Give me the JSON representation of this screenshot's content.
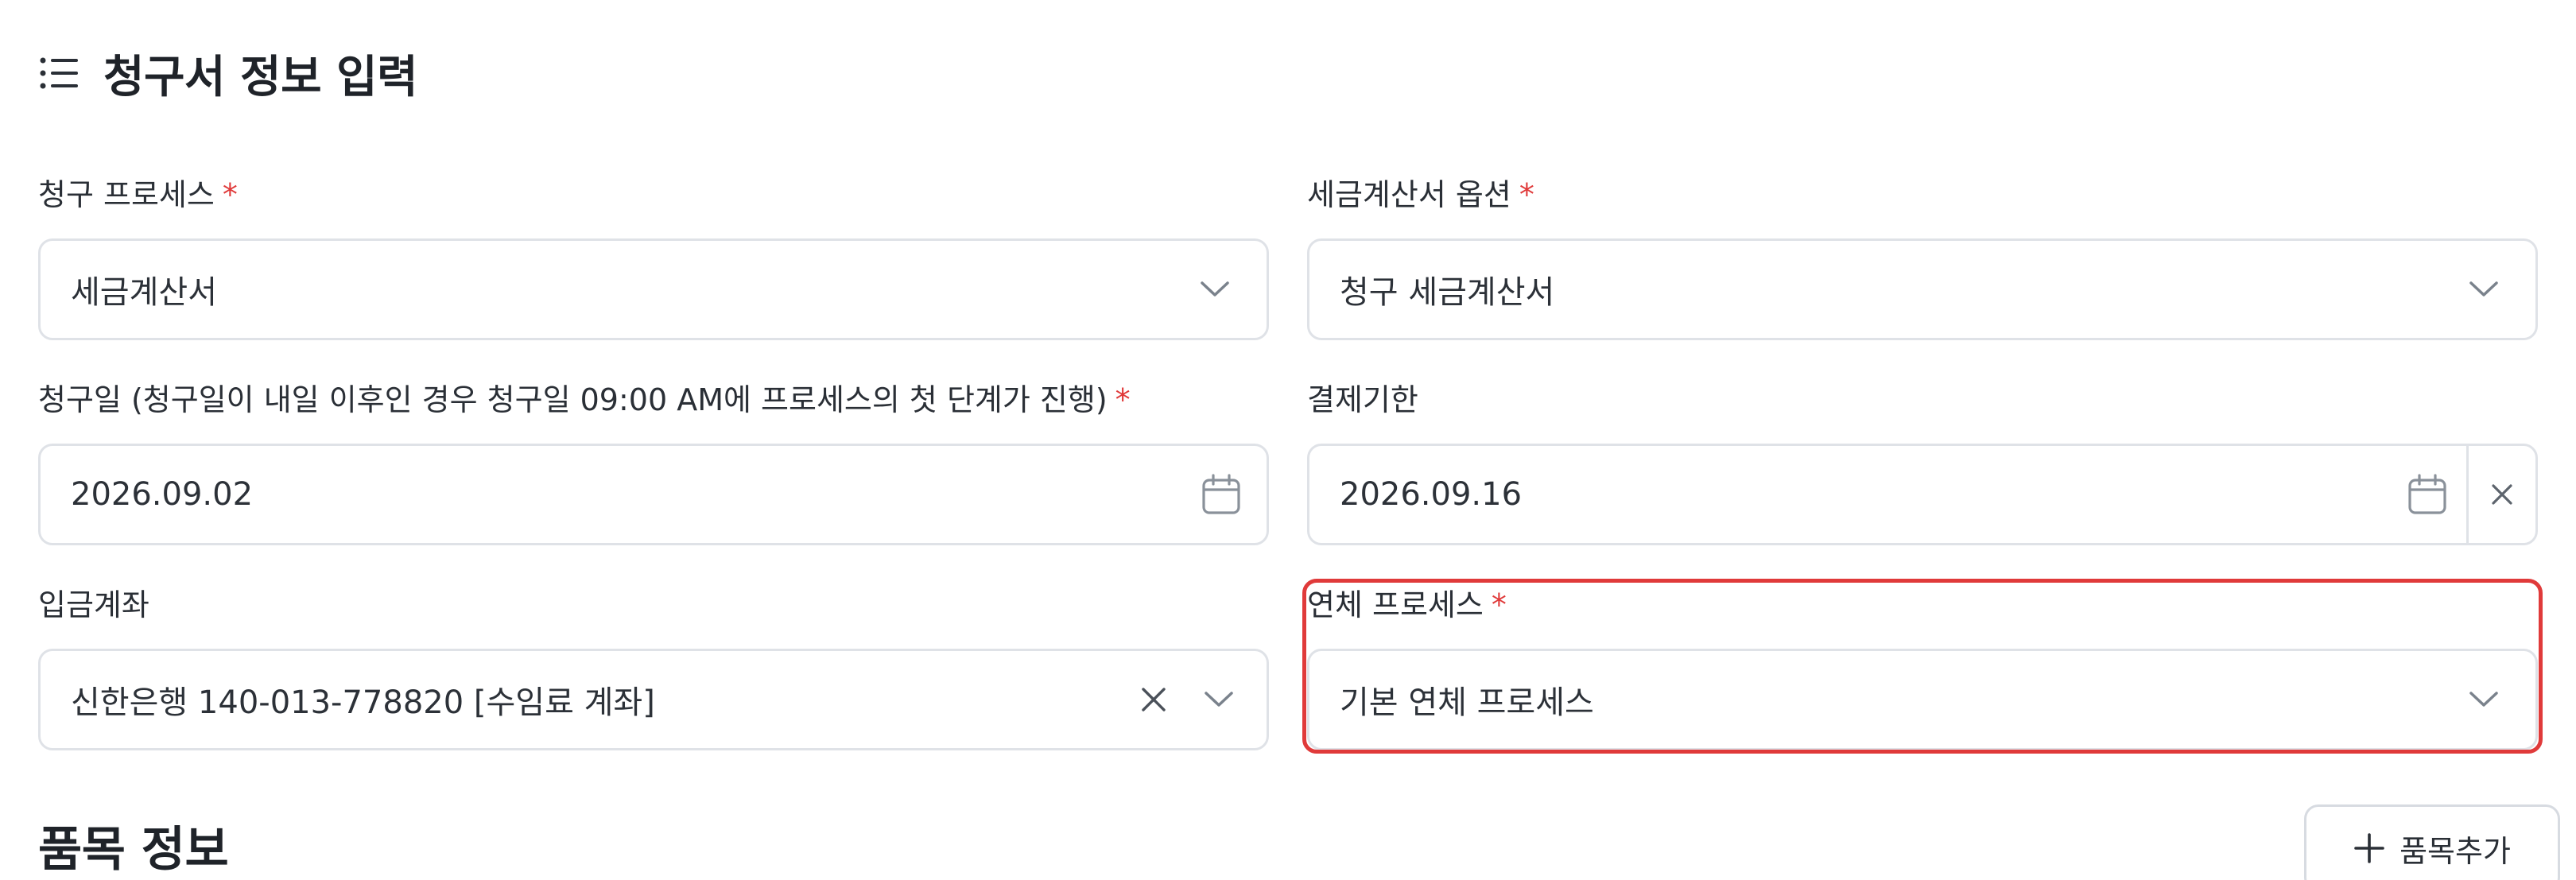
{
  "section": {
    "title": "청구서 정보 입력",
    "icon": "list-icon"
  },
  "fields": {
    "billing_process": {
      "label": "청구 프로세스",
      "required_mark": "*",
      "value": "세금계산서",
      "icon": "chevron-down-icon"
    },
    "tax_invoice_option": {
      "label": "세금계산서 옵션",
      "required_mark": "*",
      "value": "청구 세금계산서",
      "icon": "chevron-down-icon"
    },
    "billing_date": {
      "label": "청구일 (청구일이 내일 이후인 경우 청구일 09:00 AM에 프로세스의 첫 단계가 진행)",
      "required_mark": "*",
      "value": "2026.09.02",
      "icon": "calendar-icon"
    },
    "payment_due": {
      "label": "결제기한",
      "value": "2026.09.16",
      "icon": "calendar-icon",
      "clear_icon": "close-icon"
    },
    "deposit_account": {
      "label": "입금계좌",
      "value": "신한은행 140-013-778820 [수임료 계좌]",
      "clear_icon": "close-icon",
      "icon": "chevron-down-icon"
    },
    "overdue_process": {
      "label": "연체 프로세스",
      "required_mark": "*",
      "value": "기본 연체 프로세스",
      "icon": "chevron-down-icon"
    }
  },
  "items_section": {
    "title": "품목 정보",
    "add_button_label": "품목추가",
    "add_icon": "plus-icon"
  },
  "colors": {
    "required": "#e03a3a",
    "highlight": "#e03a3a",
    "border": "#dfe2e7",
    "text": "#1f2329",
    "icon": "#7a828c"
  }
}
